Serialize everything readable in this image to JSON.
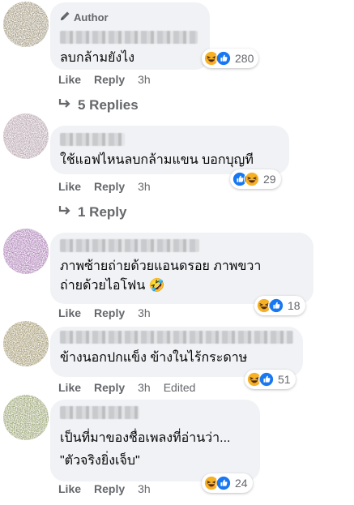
{
  "comments": [
    {
      "author_badge": "Author",
      "text": "ลบกล้ามยังไง",
      "actions": {
        "like": "Like",
        "reply": "Reply",
        "time": "3h"
      },
      "reaction_count": "280",
      "replies_label": "5 Replies"
    },
    {
      "text": "ใช้แอฟไหนลบกล้ามแขน บอกบุญที",
      "actions": {
        "like": "Like",
        "reply": "Reply",
        "time": "3h"
      },
      "reaction_count": "29",
      "replies_label": "1 Reply"
    },
    {
      "text": "ภาพซ้ายถ่ายด้วยแอนดรอย ภาพขวา\nถ่ายด้วยไอโฟน 🤣",
      "actions": {
        "like": "Like",
        "reply": "Reply",
        "time": "3h"
      },
      "reaction_count": "18"
    },
    {
      "text": "ข้างนอกปกแข็ง ข้างในไร้กระดาษ",
      "actions": {
        "like": "Like",
        "reply": "Reply",
        "time": "3h",
        "edited": "Edited"
      },
      "reaction_count": "51"
    },
    {
      "text": "เป็นที่มาของชื่อเพลงที่อ่านว่า...\n\"ตัวจริงยิ่งเจ็บ\"",
      "actions": {
        "like": "Like",
        "reply": "Reply",
        "time": "3h"
      },
      "reaction_count": "24"
    }
  ],
  "icons": {
    "haha": "laughing-face-emoji",
    "like": "blue-thumbs-up",
    "reply_arrow": "reply-arrow-icon",
    "author": "pencil-icon"
  },
  "colors": {
    "bubble": "#f0f2f5",
    "like_blue": "#1877f2",
    "haha_yellow": "#f7b125",
    "muted_text": "#65676b"
  }
}
